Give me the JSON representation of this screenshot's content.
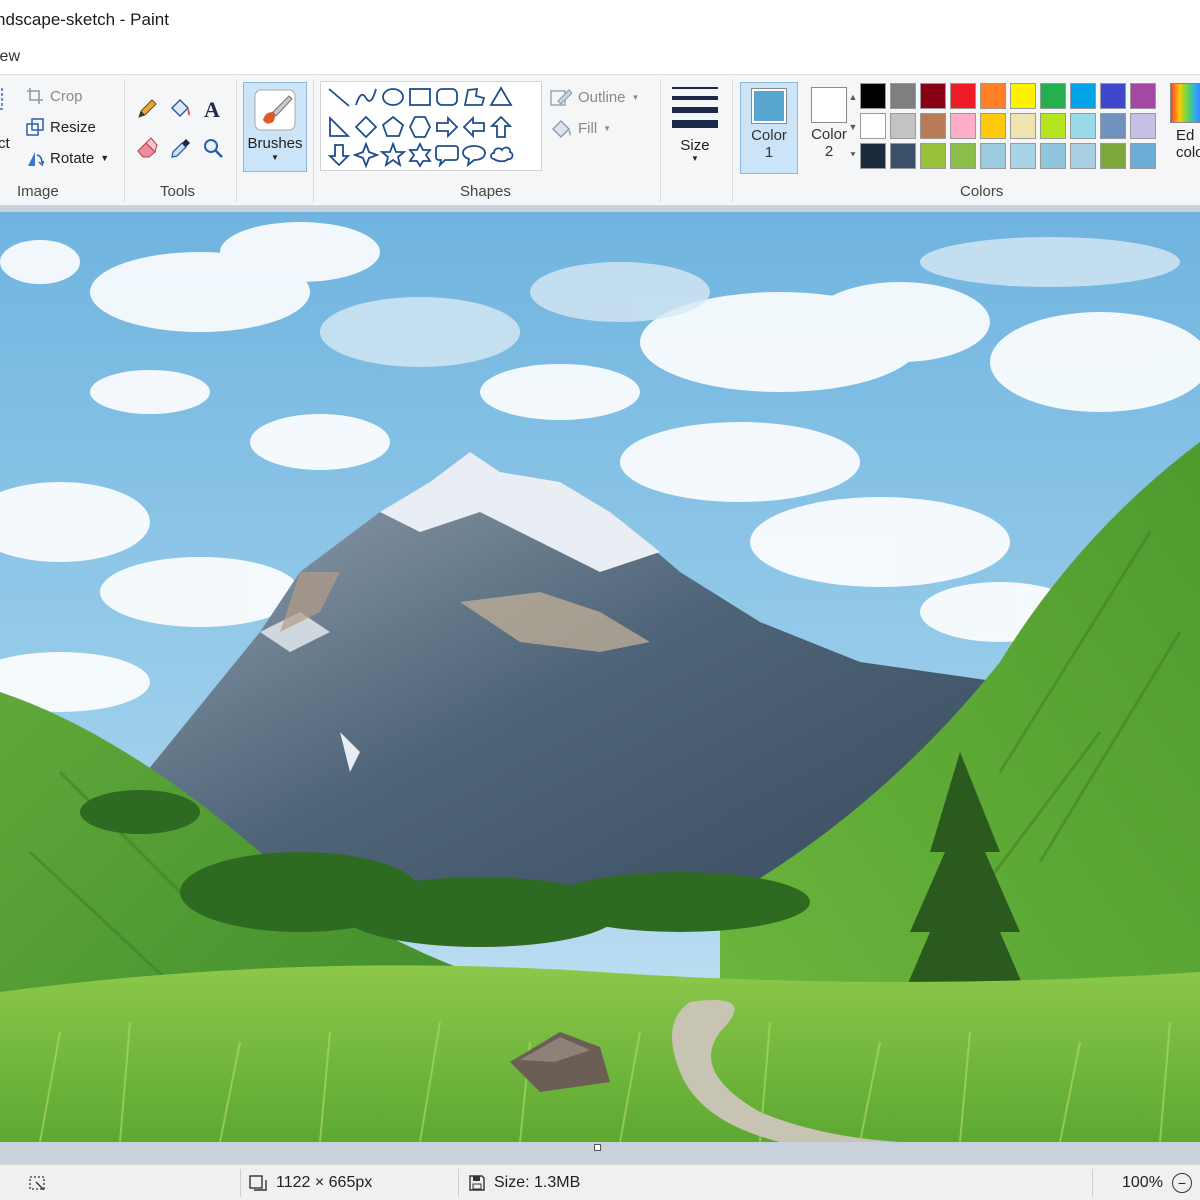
{
  "window": {
    "title": "ndscape-sketch - Paint"
  },
  "menu": {
    "view_label": "iew"
  },
  "ribbon": {
    "image_group": {
      "label": "Image",
      "crop_label": "Crop",
      "resize_label": "Resize",
      "rotate_label": "Rotate",
      "select_label": "ct"
    },
    "tools_group": {
      "label": "Tools"
    },
    "brushes_label": "Brushes",
    "shapes_group": {
      "label": "Shapes",
      "outline_label": "Outline",
      "fill_label": "Fill"
    },
    "size_label": "Size",
    "color1": {
      "label_line1": "Color",
      "label_line2": "1",
      "color": "#59a7d1"
    },
    "color2": {
      "label_line1": "Color",
      "label_line2": "2",
      "color": "#ffffff"
    },
    "colors_group": {
      "label": "Colors",
      "palette": [
        "#000000",
        "#7f7f7f",
        "#880015",
        "#ed1c24",
        "#ff7f27",
        "#fff200",
        "#22b14c",
        "#00a2e8",
        "#3f48cc",
        "#a349a4",
        "#ffffff",
        "#c3c3c3",
        "#b97a57",
        "#ffaec9",
        "#ffc90e",
        "#efe4b0",
        "#b5e61d",
        "#99d9ea",
        "#7092be",
        "#c8bfe7",
        "#1b2a3a",
        "#3a5068",
        "#9ac13c",
        "#8cbc4a",
        "#9ccbe0",
        "#a7d3e6",
        "#8fc6de",
        "#a8cfe2",
        "#7ca83a",
        "#6aaed6"
      ]
    },
    "edit_colors": {
      "label_line1": "Ed",
      "label_line2": "colo"
    }
  },
  "statusbar": {
    "dimensions": "1122 × 665px",
    "size": "Size: 1.3MB",
    "zoom": "100%"
  }
}
